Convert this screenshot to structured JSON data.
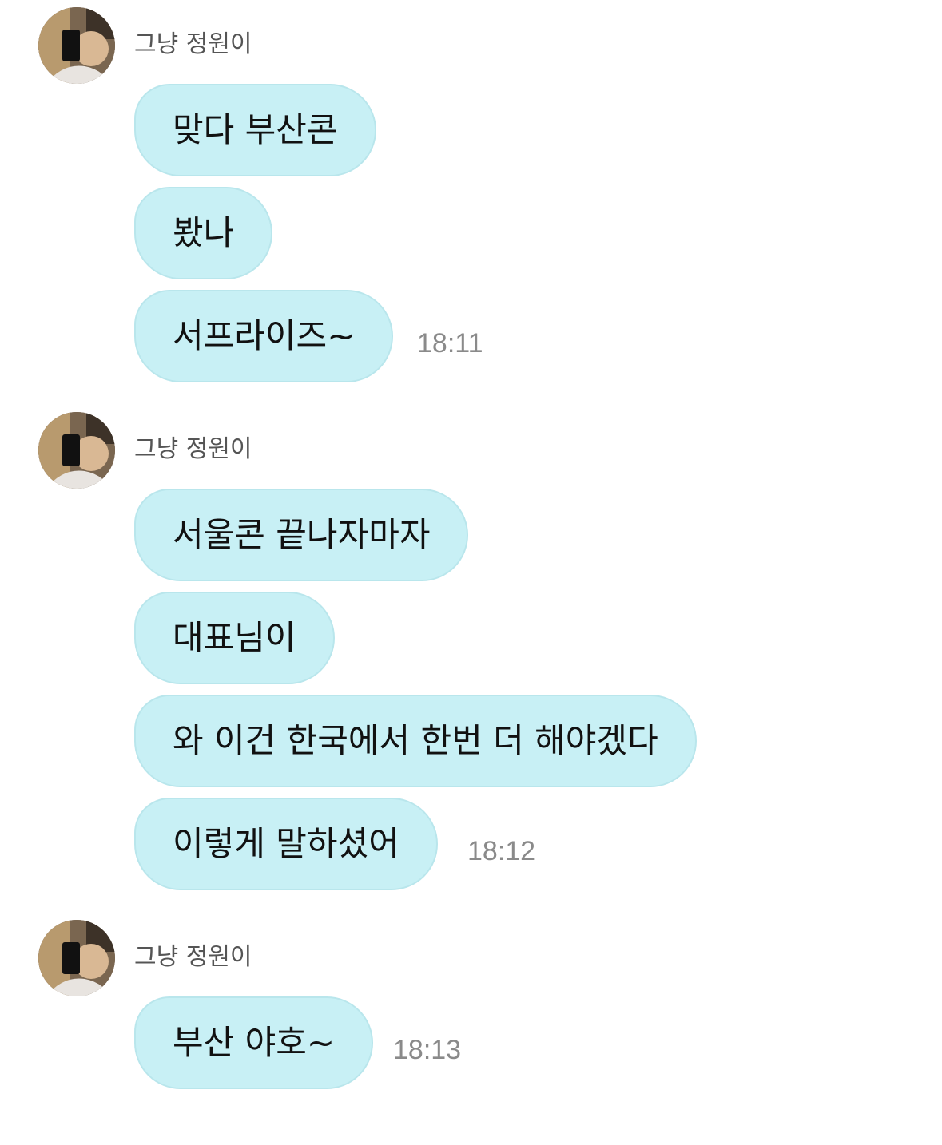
{
  "chat": {
    "groups": [
      {
        "sender": "그냥 정원이",
        "avatar_icon": "profile-photo-icon",
        "messages": [
          "맞다 부산콘",
          "봤나",
          "서프라이즈~"
        ],
        "time": "18:11"
      },
      {
        "sender": "그냥 정원이",
        "avatar_icon": "profile-photo-icon",
        "messages": [
          "서울콘 끝나자마자",
          "대표님이",
          "와 이건 한국에서 한번 더 해야겠다",
          "이렇게 말하셨어"
        ],
        "time": "18:12"
      },
      {
        "sender": "그냥 정원이",
        "avatar_icon": "profile-photo-icon",
        "messages": [
          "부산 야호~"
        ],
        "time": "18:13"
      }
    ]
  },
  "colors": {
    "bubble": "#c8f0f5",
    "bubble_border": "#b9e6ec",
    "sender_text": "#555555",
    "time_text": "#8a8a8a"
  }
}
